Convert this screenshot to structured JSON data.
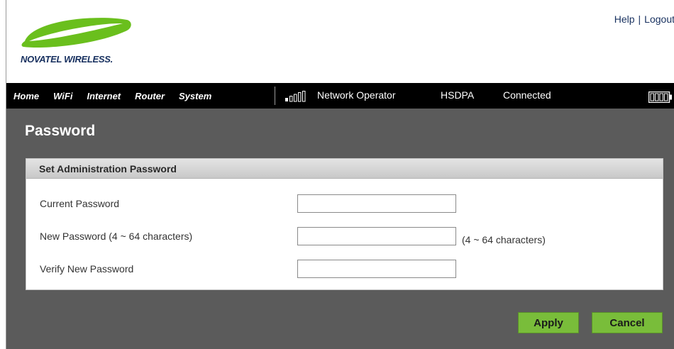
{
  "brand": {
    "logo_text": "NOVATEL WIRELESS.",
    "swoosh_color": "#6abf1d",
    "text_color": "#17305f"
  },
  "top_links": {
    "help": "Help",
    "separator": "|",
    "logout": "Logout"
  },
  "nav": {
    "items": [
      {
        "label": "Home"
      },
      {
        "label": "WiFi"
      },
      {
        "label": "Internet"
      },
      {
        "label": "Router"
      },
      {
        "label": "System"
      }
    ]
  },
  "status": {
    "signal_icon": "signal-strength-icon",
    "signal_level": 0.2,
    "operator": "Network Operator",
    "network_type": "HSDPA",
    "connection": "Connected",
    "battery_icon": "battery-icon"
  },
  "page": {
    "title": "Password"
  },
  "panel": {
    "title": "Set Administration Password",
    "fields": [
      {
        "label": "Current Password",
        "value": "",
        "hint": ""
      },
      {
        "label": "New Password (4 ~ 64 characters)",
        "value": "",
        "hint": "(4 ~ 64 characters)"
      },
      {
        "label": "Verify New Password",
        "value": "",
        "hint": ""
      }
    ]
  },
  "actions": {
    "apply": "Apply",
    "cancel": "Cancel",
    "button_color": "#79bd3a"
  }
}
